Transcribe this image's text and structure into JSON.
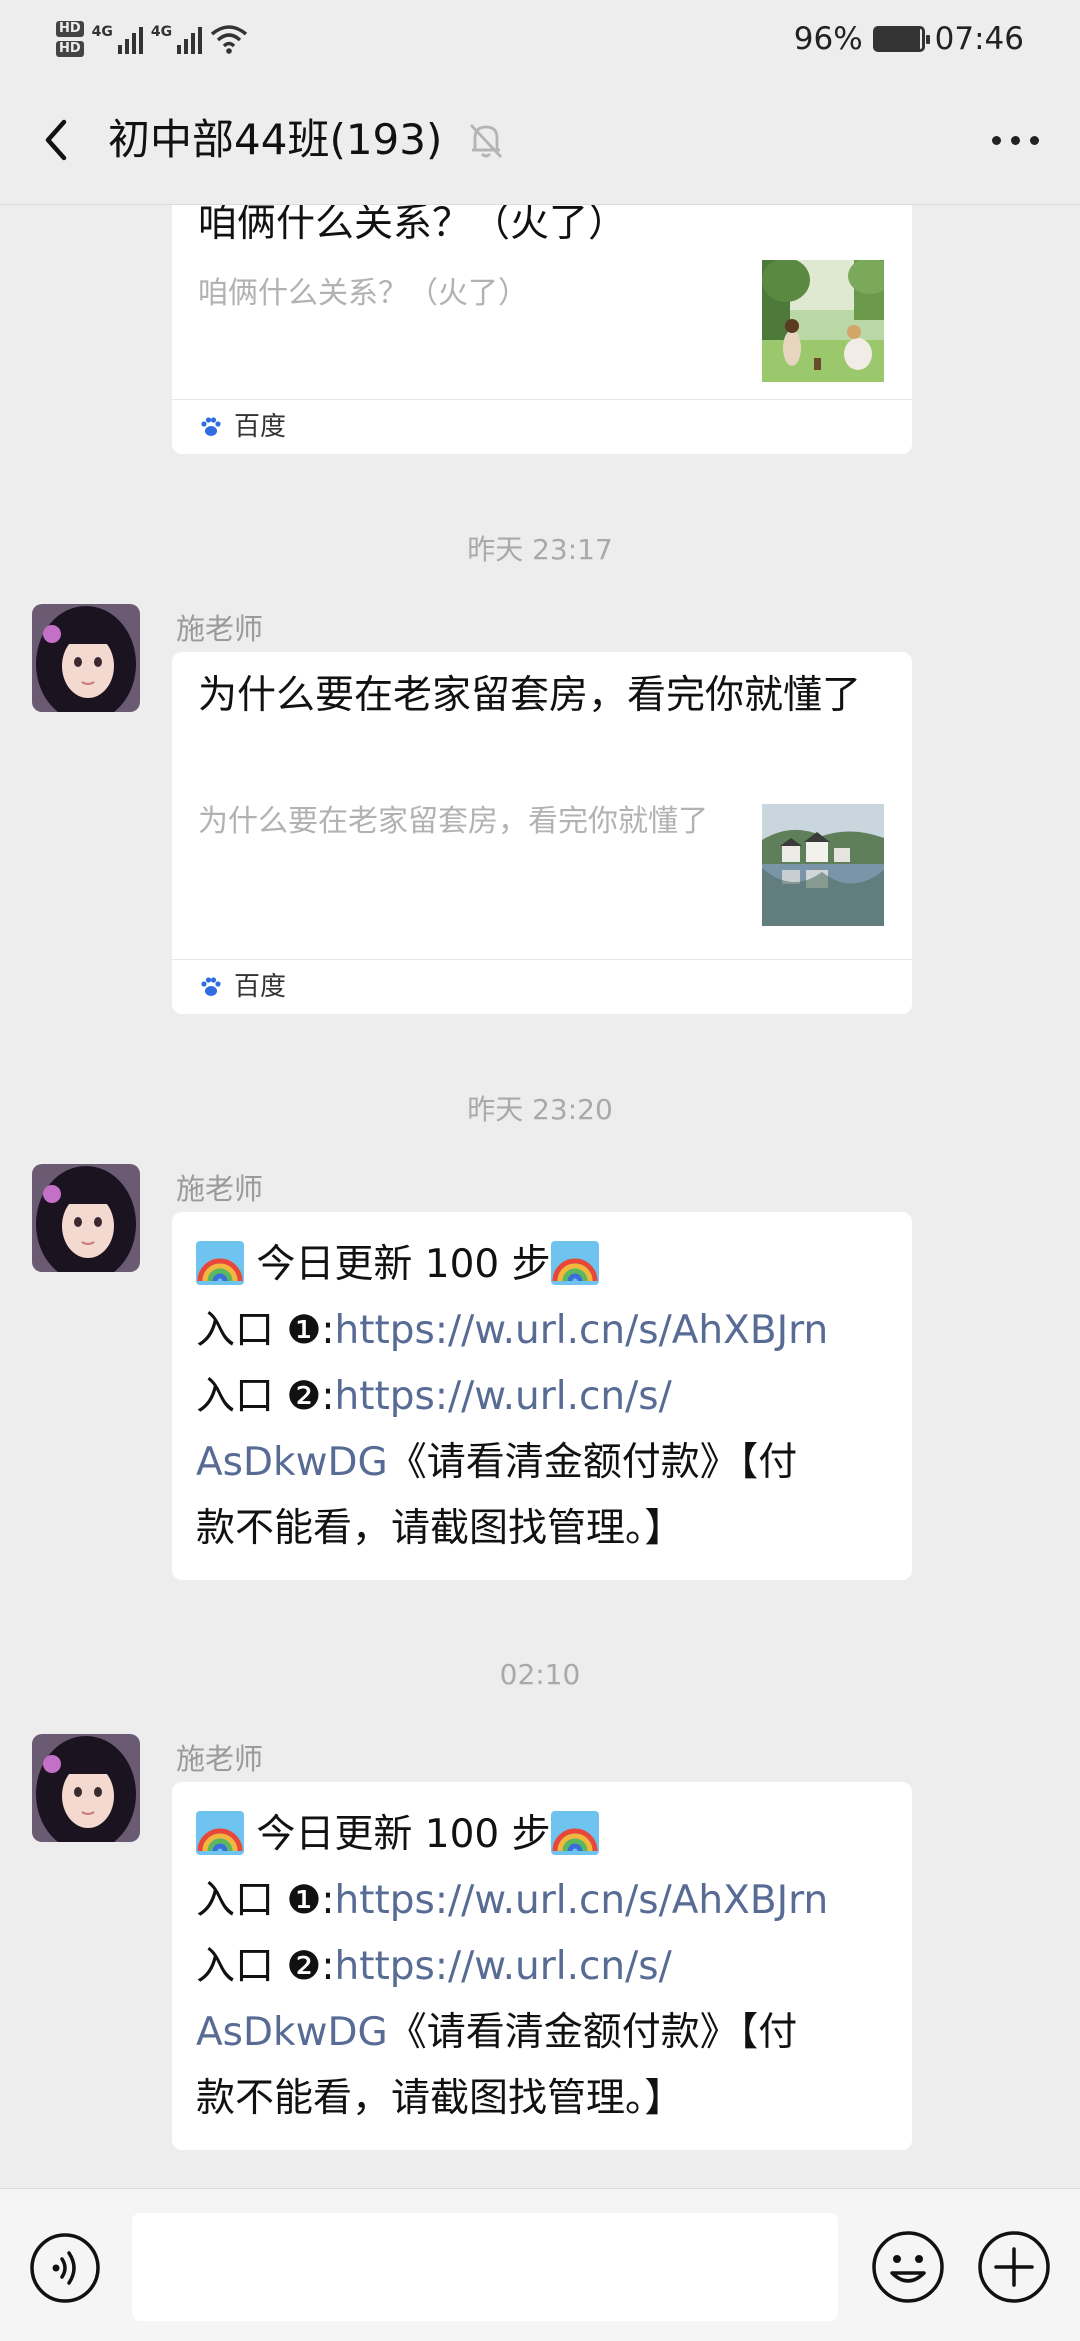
{
  "status_bar": {
    "hd1": "HD",
    "hd2": "HD",
    "net1": "4G",
    "net2": "4G",
    "battery_percent": "96%",
    "battery_level": 0.96,
    "time": "07:46"
  },
  "nav": {
    "back_icon": "chevron-left-icon",
    "title": "初中部44班(193)",
    "mute_icon": "bell-off-icon",
    "more_icon": "ellipsis-icon"
  },
  "messages": [
    {
      "type": "link_card",
      "title": "咱俩什么关系？（火了）",
      "desc": "咱俩什么关系？（火了）",
      "source": "百度",
      "source_icon": "baidu-paw-icon"
    },
    {
      "type": "timestamp",
      "text": "昨天 23:17"
    },
    {
      "type": "link_card",
      "sender": "施老师",
      "title": "为什么要在老家留套房，看完你就懂了",
      "desc": "为什么要在老家留套房，看完你就懂了",
      "source": "百度",
      "source_icon": "baidu-paw-icon"
    },
    {
      "type": "timestamp",
      "text": "昨天 23:20"
    },
    {
      "type": "text",
      "sender": "施老师",
      "emoji_icon": "rainbow-icon",
      "line1": " 今日更新 100 步",
      "entry1_label": "入口 ❶:",
      "entry1_url": "https://w.url.cn/s/AhXBJrn",
      "entry2_label": "入口 ❷:",
      "entry2_url_a": "https://w.url.cn/s/",
      "entry2_url_b": "AsDkwDG",
      "tail_a": "《请看清金额付款》【付",
      "tail_b": "款不能看，请截图找管理。】"
    },
    {
      "type": "timestamp",
      "text": "02:10"
    },
    {
      "type": "text",
      "sender": "施老师",
      "emoji_icon": "rainbow-icon",
      "line1": " 今日更新 100 步",
      "entry1_label": "入口 ❶:",
      "entry1_url": "https://w.url.cn/s/AhXBJrn",
      "entry2_label": "入口 ❷:",
      "entry2_url_a": "https://w.url.cn/s/",
      "entry2_url_b": "AsDkwDG",
      "tail_a": "《请看清金额付款》【付",
      "tail_b": "款不能看，请截图找管理。】"
    }
  ],
  "input_bar": {
    "voice_icon": "voice-icon",
    "emoji_icon": "smiley-icon",
    "plus_icon": "plus-icon"
  }
}
